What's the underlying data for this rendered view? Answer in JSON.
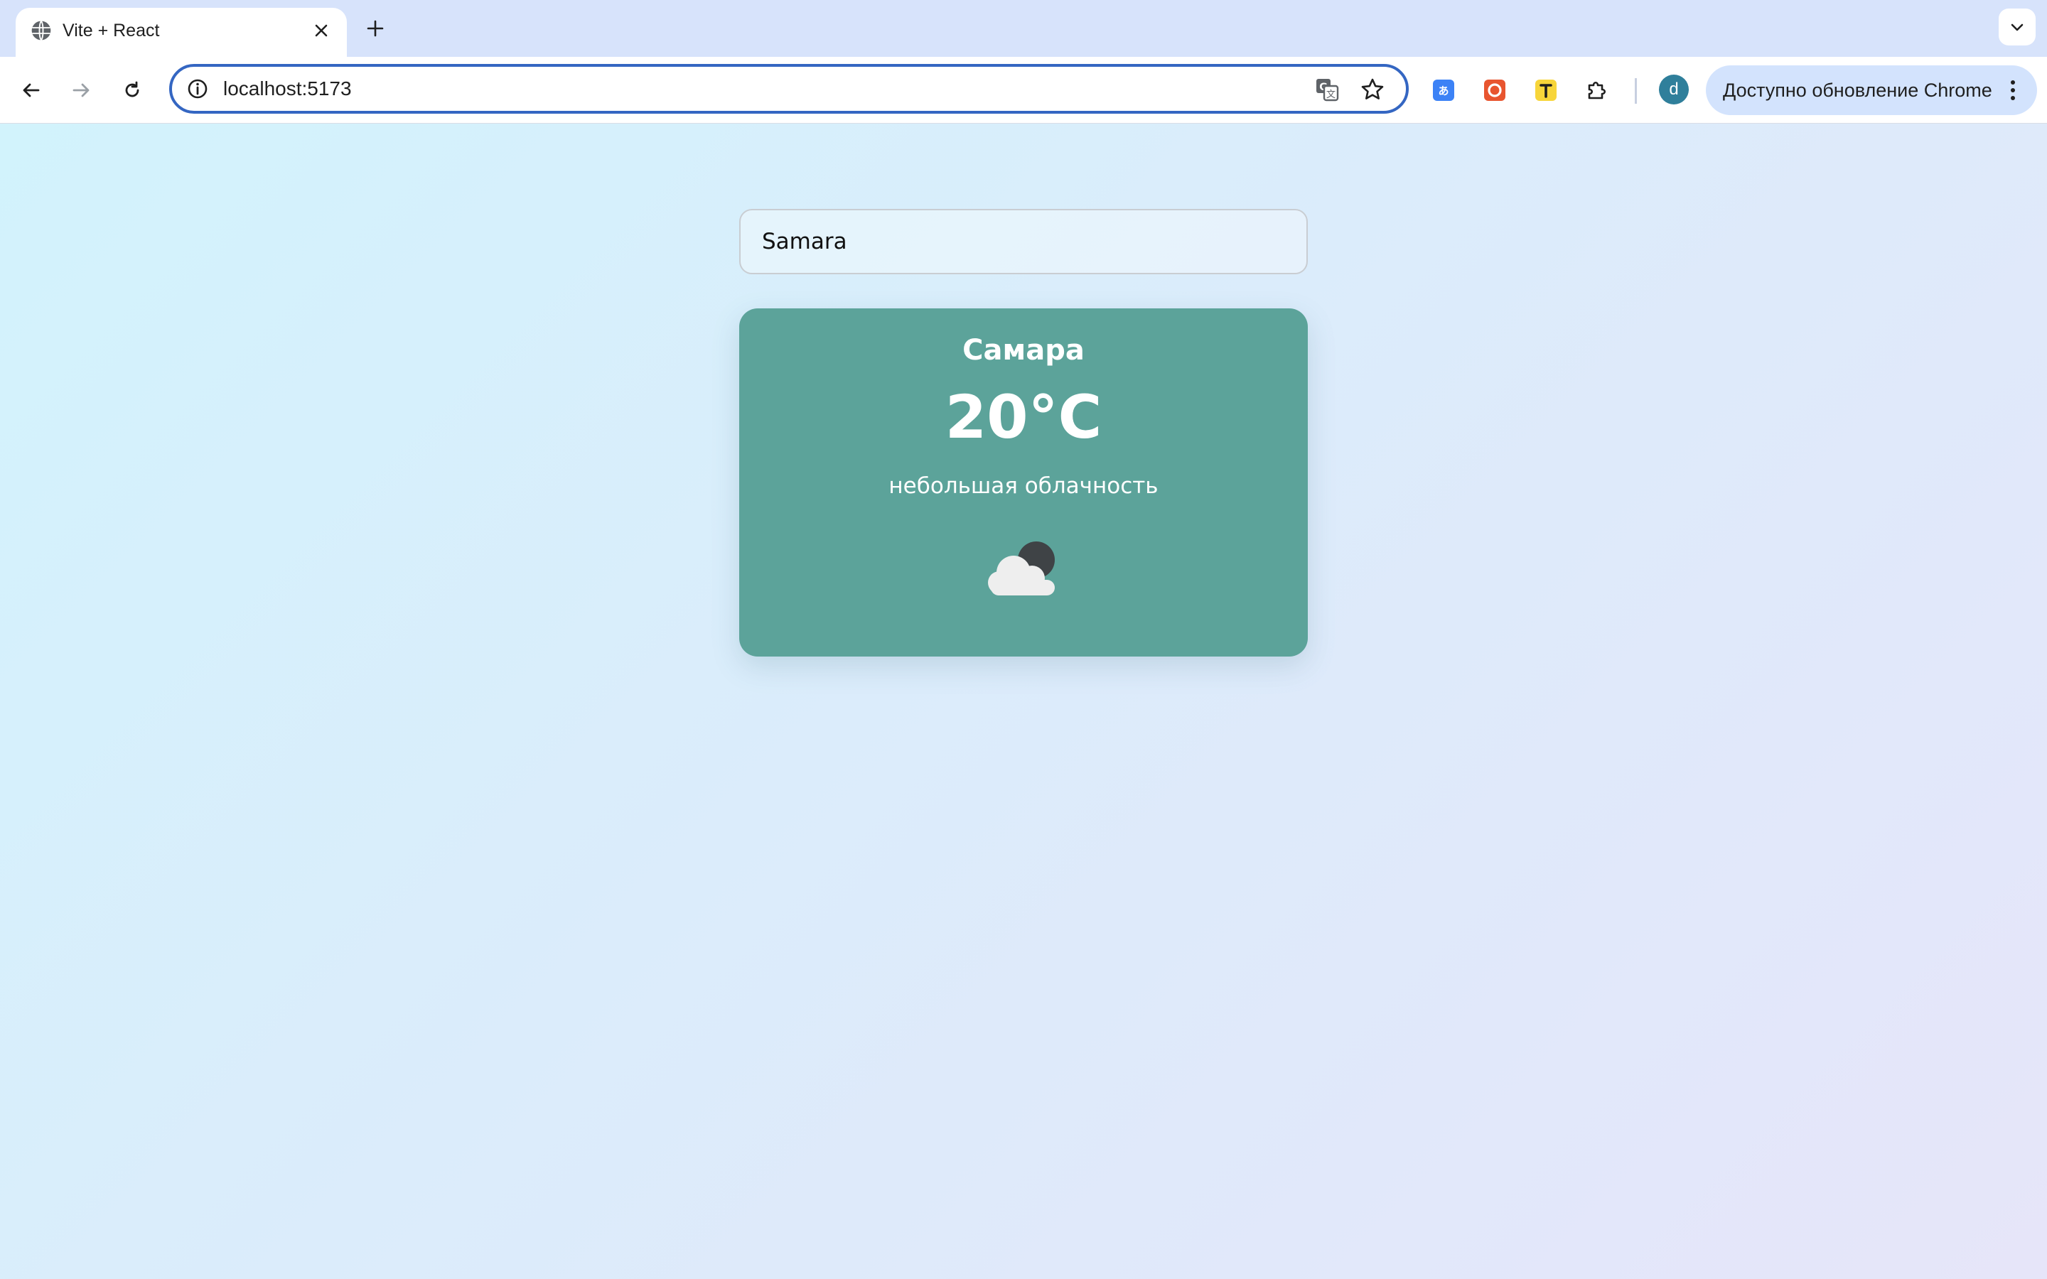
{
  "browser": {
    "tab": {
      "title": "Vite + React",
      "favicon": "globe-icon"
    },
    "address": {
      "url": "localhost:5173"
    },
    "update_button": {
      "label": "Доступно обновление Chrome"
    },
    "profile": {
      "initial": "d",
      "color": "#2f7f9b"
    },
    "accent_color": "#3466c2"
  },
  "app": {
    "search": {
      "value": "Samara"
    },
    "weather": {
      "city": "Самара",
      "temperature": "20°C",
      "description": "небольшая облачность",
      "icon": "cloud-night-icon"
    },
    "card_color": "#5ca39a"
  }
}
